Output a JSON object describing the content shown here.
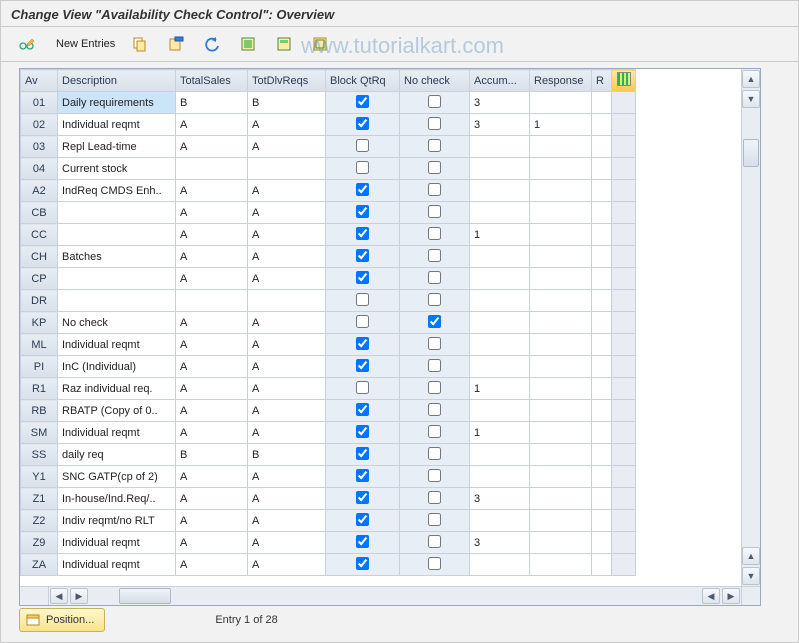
{
  "title": "Change View \"Availability Check Control\": Overview",
  "watermark": "www.tutorialkart.com",
  "toolbar": {
    "new_entries": "New Entries"
  },
  "columns": {
    "av": "Av",
    "desc": "Description",
    "ts": "TotalSales",
    "td": "TotDlvReqs",
    "bq": "Block QtRq",
    "nc": "No check",
    "acc": "Accum...",
    "resp": "Response",
    "re": "R"
  },
  "rows": [
    {
      "av": "01",
      "desc": "Daily requirements",
      "ts": "B",
      "td": "B",
      "bq": true,
      "nc": false,
      "acc": "3",
      "resp": "",
      "sel": true
    },
    {
      "av": "02",
      "desc": "Individual reqmt",
      "ts": "A",
      "td": "A",
      "bq": true,
      "nc": false,
      "acc": "3",
      "resp": "1"
    },
    {
      "av": "03",
      "desc": "Repl Lead-time",
      "ts": "A",
      "td": "A",
      "bq": false,
      "nc": false,
      "acc": "",
      "resp": ""
    },
    {
      "av": "04",
      "desc": "Current stock",
      "ts": "",
      "td": "",
      "bq": false,
      "nc": false,
      "acc": "",
      "resp": ""
    },
    {
      "av": "A2",
      "desc": "IndReq CMDS Enh..",
      "ts": "A",
      "td": "A",
      "bq": true,
      "nc": false,
      "acc": "",
      "resp": ""
    },
    {
      "av": "CB",
      "desc": "",
      "ts": "A",
      "td": "A",
      "bq": true,
      "nc": false,
      "acc": "",
      "resp": ""
    },
    {
      "av": "CC",
      "desc": "",
      "ts": "A",
      "td": "A",
      "bq": true,
      "nc": false,
      "acc": "1",
      "resp": ""
    },
    {
      "av": "CH",
      "desc": "Batches",
      "ts": "A",
      "td": "A",
      "bq": true,
      "nc": false,
      "acc": "",
      "resp": ""
    },
    {
      "av": "CP",
      "desc": "",
      "ts": "A",
      "td": "A",
      "bq": true,
      "nc": false,
      "acc": "",
      "resp": ""
    },
    {
      "av": "DR",
      "desc": "",
      "ts": "",
      "td": "",
      "bq": false,
      "nc": false,
      "acc": "",
      "resp": ""
    },
    {
      "av": "KP",
      "desc": "No check",
      "ts": "A",
      "td": "A",
      "bq": false,
      "nc": true,
      "acc": "",
      "resp": ""
    },
    {
      "av": "ML",
      "desc": "Individual reqmt",
      "ts": "A",
      "td": "A",
      "bq": true,
      "nc": false,
      "acc": "",
      "resp": ""
    },
    {
      "av": "PI",
      "desc": "InC (Individual)",
      "ts": "A",
      "td": "A",
      "bq": true,
      "nc": false,
      "acc": "",
      "resp": ""
    },
    {
      "av": "R1",
      "desc": "Raz individual req.",
      "ts": "A",
      "td": "A",
      "bq": false,
      "nc": false,
      "acc": "1",
      "resp": ""
    },
    {
      "av": "RB",
      "desc": "RBATP (Copy of 0..",
      "ts": "A",
      "td": "A",
      "bq": true,
      "nc": false,
      "acc": "",
      "resp": ""
    },
    {
      "av": "SM",
      "desc": "Individual reqmt",
      "ts": "A",
      "td": "A",
      "bq": true,
      "nc": false,
      "acc": "1",
      "resp": ""
    },
    {
      "av": "SS",
      "desc": "daily req",
      "ts": "B",
      "td": "B",
      "bq": true,
      "nc": false,
      "acc": "",
      "resp": ""
    },
    {
      "av": "Y1",
      "desc": "SNC GATP(cp of 2)",
      "ts": "A",
      "td": "A",
      "bq": true,
      "nc": false,
      "acc": "",
      "resp": ""
    },
    {
      "av": "Z1",
      "desc": "In-house/Ind.Req/..",
      "ts": "A",
      "td": "A",
      "bq": true,
      "nc": false,
      "acc": "3",
      "resp": ""
    },
    {
      "av": "Z2",
      "desc": "Indiv reqmt/no RLT",
      "ts": "A",
      "td": "A",
      "bq": true,
      "nc": false,
      "acc": "",
      "resp": ""
    },
    {
      "av": "Z9",
      "desc": "Individual reqmt",
      "ts": "A",
      "td": "A",
      "bq": true,
      "nc": false,
      "acc": "3",
      "resp": ""
    },
    {
      "av": "ZA",
      "desc": "Individual reqmt",
      "ts": "A",
      "td": "A",
      "bq": true,
      "nc": false,
      "acc": "",
      "resp": ""
    }
  ],
  "footer": {
    "position": "Position...",
    "entry": "Entry 1 of 28"
  }
}
